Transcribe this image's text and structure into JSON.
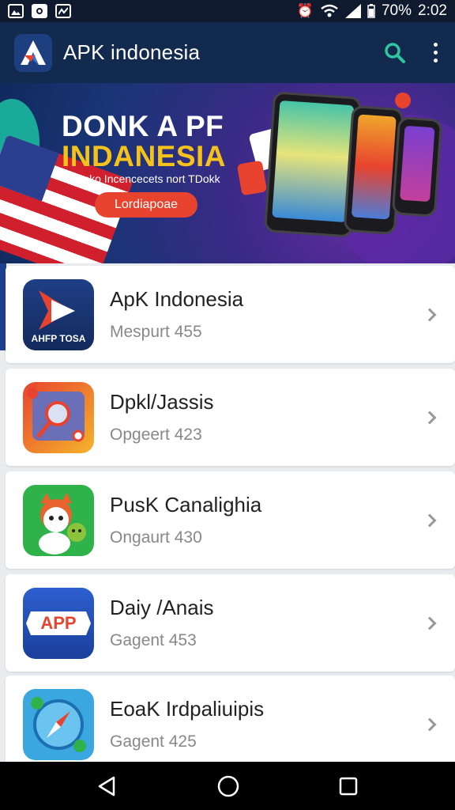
{
  "status_bar": {
    "battery": "70%",
    "time": "2:02",
    "icons": [
      "image-icon",
      "square-app-icon",
      "photos-icon",
      "alarm-icon",
      "wifi-icon",
      "signal-icon",
      "battery-icon"
    ]
  },
  "app_bar": {
    "title": "APK indonesia",
    "icons": {
      "search": "search-icon",
      "more": "more-vertical-icon"
    },
    "colors": {
      "background": "#132a4f",
      "search": "#2fc6a0"
    }
  },
  "banner": {
    "line1": "DONK A PF",
    "line2": "INDANESIA",
    "subtitle": "Aeko Incencecets nort TDokk",
    "button": "Lordiapoae",
    "colors": {
      "line1": "#ffffff",
      "line2": "#f5c21b",
      "button": "#e8432e"
    }
  },
  "apps": [
    {
      "name": "ApK Indonesia",
      "meta": "Mespurt 455",
      "icon_label": "AHFP TOSA",
      "icon": "apk-logo-icon"
    },
    {
      "name": "Dpkl/Jassis",
      "meta": "Opgeert 423",
      "icon": "magnifier-app-icon"
    },
    {
      "name": "PusK Canalighia",
      "meta": "Ongaurt 430",
      "icon": "mascot-app-icon"
    },
    {
      "name": "Daiy /Anais",
      "meta": "Gagent 453",
      "icon_label": "APP",
      "icon": "app-badge-icon"
    },
    {
      "name": "EoaK Irdpaliuipis",
      "meta": "Gagent 425",
      "icon": "compass-app-icon"
    }
  ],
  "nav_bar": {
    "icons": [
      "back-icon",
      "home-icon",
      "recents-icon"
    ]
  }
}
